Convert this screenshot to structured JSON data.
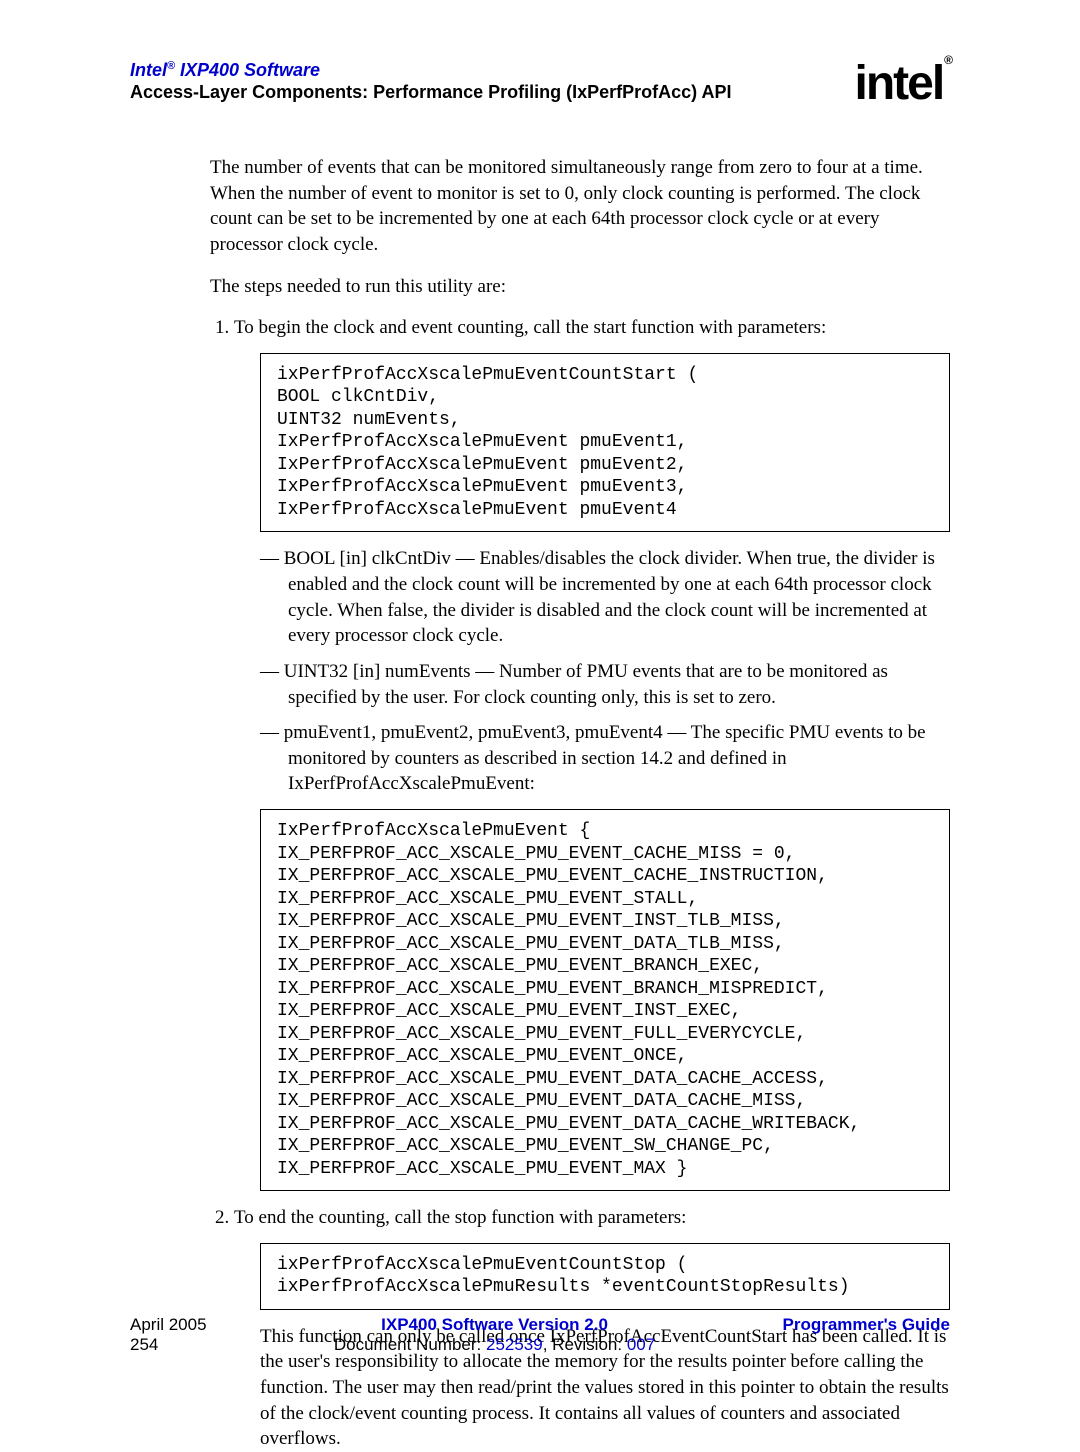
{
  "header": {
    "product_title_prefix": "Intel",
    "product_title_reg": "®",
    "product_title_suffix": " IXP400 Software",
    "section_title": "Access-Layer Components: Performance Profiling (IxPerfProfAcc) API",
    "logo_text": "intel",
    "logo_reg": "®"
  },
  "body": {
    "para1": "The number of events that can be monitored simultaneously range from zero to four at a time. When the number of event to monitor is set to 0, only clock counting is performed. The clock count can be set to be incremented by one at each 64th processor clock cycle or at every processor clock cycle.",
    "para2": "The steps needed to run this utility are:",
    "step1_intro": "To begin the clock and event counting, call the start function with parameters:",
    "code1": "ixPerfProfAccXscalePmuEventCountStart (\nBOOL clkCntDiv,\nUINT32 numEvents,\nIxPerfProfAccXscalePmuEvent pmuEvent1,\nIxPerfProfAccXscalePmuEvent pmuEvent2,\nIxPerfProfAccXscalePmuEvent pmuEvent3,\nIxPerfProfAccXscalePmuEvent pmuEvent4",
    "dash1": "BOOL [in] clkCntDiv — Enables/disables the clock divider. When true, the divider is enabled and the clock count will be incremented by one at each 64th processor clock cycle. When false, the divider is disabled and the clock count will be incremented at every processor clock cycle.",
    "dash2": "UINT32 [in] numEvents — Number of PMU events that are to be monitored as specified by the user. For clock counting only, this is set to zero.",
    "dash3": "pmuEvent1, pmuEvent2, pmuEvent3, pmuEvent4 — The specific PMU events to be monitored by counters as described in section 14.2 and defined in IxPerfProfAccXscalePmuEvent:",
    "code2": "IxPerfProfAccXscalePmuEvent {\nIX_PERFPROF_ACC_XSCALE_PMU_EVENT_CACHE_MISS = 0,\nIX_PERFPROF_ACC_XSCALE_PMU_EVENT_CACHE_INSTRUCTION,\nIX_PERFPROF_ACC_XSCALE_PMU_EVENT_STALL,\nIX_PERFPROF_ACC_XSCALE_PMU_EVENT_INST_TLB_MISS,\nIX_PERFPROF_ACC_XSCALE_PMU_EVENT_DATA_TLB_MISS,\nIX_PERFPROF_ACC_XSCALE_PMU_EVENT_BRANCH_EXEC,\nIX_PERFPROF_ACC_XSCALE_PMU_EVENT_BRANCH_MISPREDICT,\nIX_PERFPROF_ACC_XSCALE_PMU_EVENT_INST_EXEC,\nIX_PERFPROF_ACC_XSCALE_PMU_EVENT_FULL_EVERYCYCLE,\nIX_PERFPROF_ACC_XSCALE_PMU_EVENT_ONCE,\nIX_PERFPROF_ACC_XSCALE_PMU_EVENT_DATA_CACHE_ACCESS,\nIX_PERFPROF_ACC_XSCALE_PMU_EVENT_DATA_CACHE_MISS,\nIX_PERFPROF_ACC_XSCALE_PMU_EVENT_DATA_CACHE_WRITEBACK,\nIX_PERFPROF_ACC_XSCALE_PMU_EVENT_SW_CHANGE_PC,\nIX_PERFPROF_ACC_XSCALE_PMU_EVENT_MAX }",
    "step2_intro": "To end the counting, call the stop function with parameters:",
    "code3": "ixPerfProfAccXscalePmuEventCountStop (\nixPerfProfAccXscalePmuResults *eventCountStopResults)",
    "after2": "This function can only be called once IxPerfProfAccEventCountStart has been called. It is the user's responsibility to allocate the memory for the results pointer before calling the function. The user may then read/print the values stored in this pointer to obtain the results of the clock/event counting process. It contains all values of counters and associated overflows."
  },
  "footer": {
    "date": "April 2005",
    "page": "254",
    "center_bold": "IXP400 Software Version 2.0",
    "docnum_label": "Document Number: ",
    "docnum": "252539",
    "rev_label": ", Revision: ",
    "rev": "007",
    "guide": "Programmer's Guide"
  }
}
